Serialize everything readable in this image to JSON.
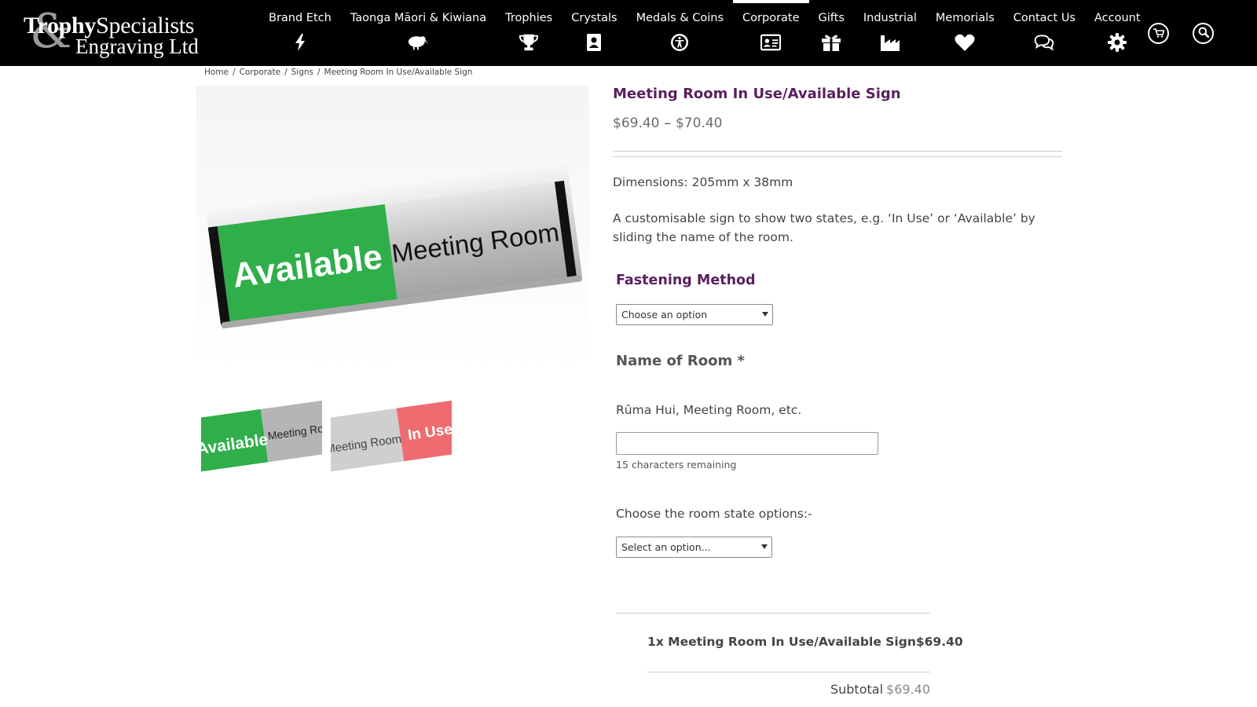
{
  "header": {
    "logo": {
      "text_trophy": "Trophy",
      "text_specialists": "Specialists",
      "text_amp": "&",
      "text_engraving": "Engraving Ltd"
    },
    "nav": [
      {
        "label": "Brand Etch",
        "icon": "bolt-icon"
      },
      {
        "label": "Taonga Māori & Kiwiana",
        "icon": "kiwi-icon"
      },
      {
        "label": "Trophies",
        "icon": "trophy-icon"
      },
      {
        "label": "Crystals",
        "icon": "address-book-icon"
      },
      {
        "label": "Medals & Coins",
        "icon": "accessibility-icon"
      },
      {
        "label": "Corporate",
        "icon": "id-card-icon",
        "active": true
      },
      {
        "label": "Gifts",
        "icon": "gift-icon"
      },
      {
        "label": "Industrial",
        "icon": "industry-icon"
      },
      {
        "label": "Memorials",
        "icon": "heart-icon"
      },
      {
        "label": "Contact Us",
        "icon": "comments-icon"
      },
      {
        "label": "Account",
        "icon": "gear-icon"
      }
    ],
    "cart_icon": "cart-icon",
    "search_icon": "search-icon"
  },
  "breadcrumb": [
    "Home",
    "Corporate",
    "Signs",
    "Meeting Room In Use/Available Sign"
  ],
  "gallery": {
    "main_sign": {
      "left_text": "Available",
      "right_text": "Meeting Room",
      "left_color": "#2fae4a"
    },
    "thumbs": [
      {
        "left_text": "Available",
        "right_text": "Meeting Roo",
        "left_color": "#2fae4a"
      },
      {
        "left_text": "Meeting Room",
        "right_text": "In Use",
        "right_color": "#ee6b70"
      }
    ]
  },
  "product": {
    "title": "Meeting Room In Use/Available Sign",
    "price_min": "$69.40",
    "price_sep": "–",
    "price_max": "$70.40",
    "dimensions": "Dimensions: 205mm x 38mm",
    "description": "A customisable sign to show two states, e.g. ‘In Use’ or ‘Available’ by sliding the name of the room."
  },
  "options": {
    "fastening": {
      "heading": "Fastening Method",
      "selected": "Choose an option"
    },
    "room_name": {
      "heading": "Name of Room *",
      "hint": "Rūma Hui, Meeting Room, etc.",
      "value": "",
      "remaining": "15 characters remaining"
    },
    "room_state": {
      "heading": "Choose the room state options:-",
      "selected": "Select an option..."
    }
  },
  "summary": {
    "line_item": "1x Meeting Room In Use/Available Sign",
    "line_price": "$69.40",
    "subtotal_label": "Subtotal",
    "subtotal_value": "$69.40"
  },
  "colors": {
    "accent": "#5a1f5e",
    "header_bg": "#000000"
  }
}
